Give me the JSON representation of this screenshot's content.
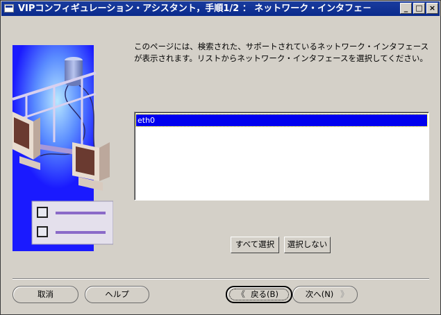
{
  "window": {
    "title": "VIPコンフィギュレーション・アシスタント，手順1/2 ： ネットワーク・インタフェ－"
  },
  "titlebar_buttons": {
    "minimize": "_",
    "maximize": "□",
    "close": "×"
  },
  "main": {
    "description": "このページには、検索された、サポートされているネットワーク・インタフェースが表示されます。リストからネットワーク・インタフェースを選択してください。",
    "interfaces": [
      "eth0"
    ],
    "selected_interface": "eth0",
    "select_all_label": "すべて選択",
    "deselect_label": "選択しない"
  },
  "footer": {
    "cancel_label": "取消",
    "help_label": "ヘルプ",
    "back_label": "戻る(B)",
    "next_label": "次へ(N)"
  },
  "colors": {
    "titlebar": "#0a2a8c",
    "selection": "#0000ee",
    "panel_blue": "#1a1aff",
    "background": "#d4d0c8"
  }
}
